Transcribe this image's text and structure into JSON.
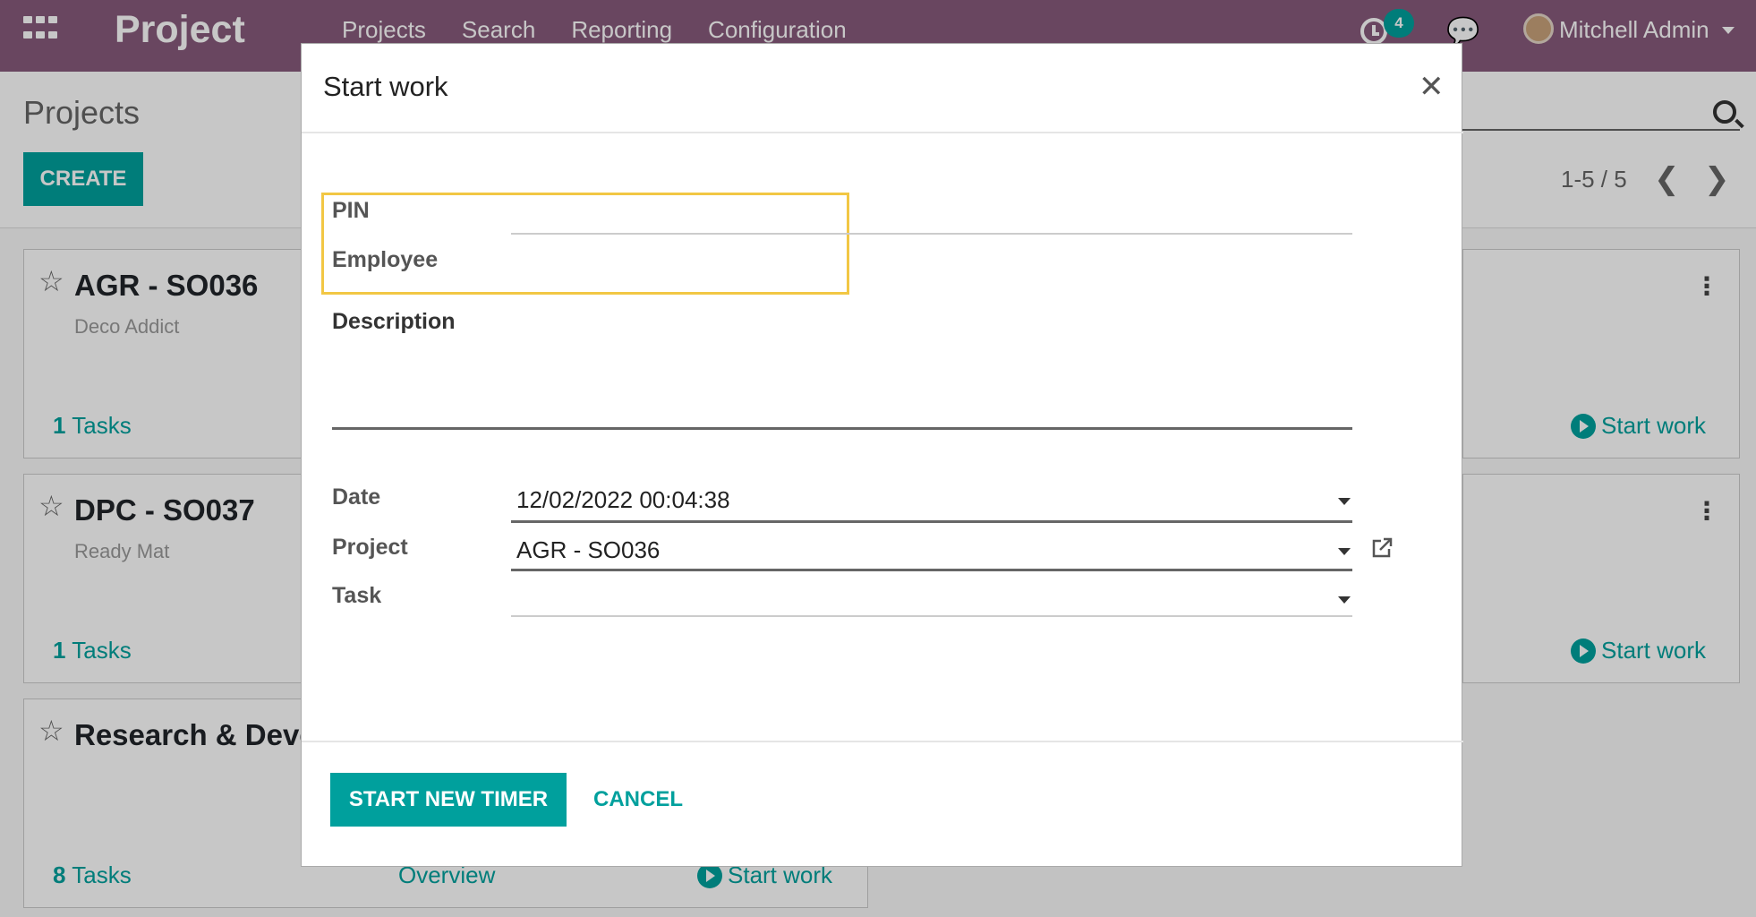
{
  "navbar": {
    "brand": "Project",
    "menu": [
      "Projects",
      "Search",
      "Reporting",
      "Configuration"
    ],
    "activity_count": "4",
    "user_name": "Mitchell Admin"
  },
  "control_panel": {
    "breadcrumb": "Projects",
    "create_label": "CREATE",
    "pager": "1-5 / 5"
  },
  "cards": [
    {
      "title": "AGR - SO036",
      "subtitle": "Deco Addict",
      "task_count": "1",
      "tasks_label": "Tasks",
      "overview_label": "",
      "start_label": "Start work"
    },
    {
      "title": "DPC - SO037",
      "subtitle": "Ready Mat",
      "task_count": "1",
      "tasks_label": "Tasks",
      "overview_label": "",
      "start_label": "Start work"
    },
    {
      "title": "Research & Development",
      "subtitle": "",
      "task_count": "8",
      "tasks_label": "Tasks",
      "overview_label": "Overview",
      "start_label": "Start work"
    }
  ],
  "dialog": {
    "title": "Start work",
    "fields": {
      "pin_label": "PIN",
      "pin_value": "",
      "employee_label": "Employee",
      "employee_value": "",
      "description_label": "Description",
      "date_label": "Date",
      "date_value": "12/02/2022 00:04:38",
      "project_label": "Project",
      "project_value": "AGR - SO036",
      "task_label": "Task",
      "task_value": ""
    },
    "start_button": "START NEW TIMER",
    "cancel_button": "CANCEL"
  },
  "colors": {
    "navbar": "#875a7b",
    "primary": "#00a09d",
    "highlight": "#f2c744"
  }
}
